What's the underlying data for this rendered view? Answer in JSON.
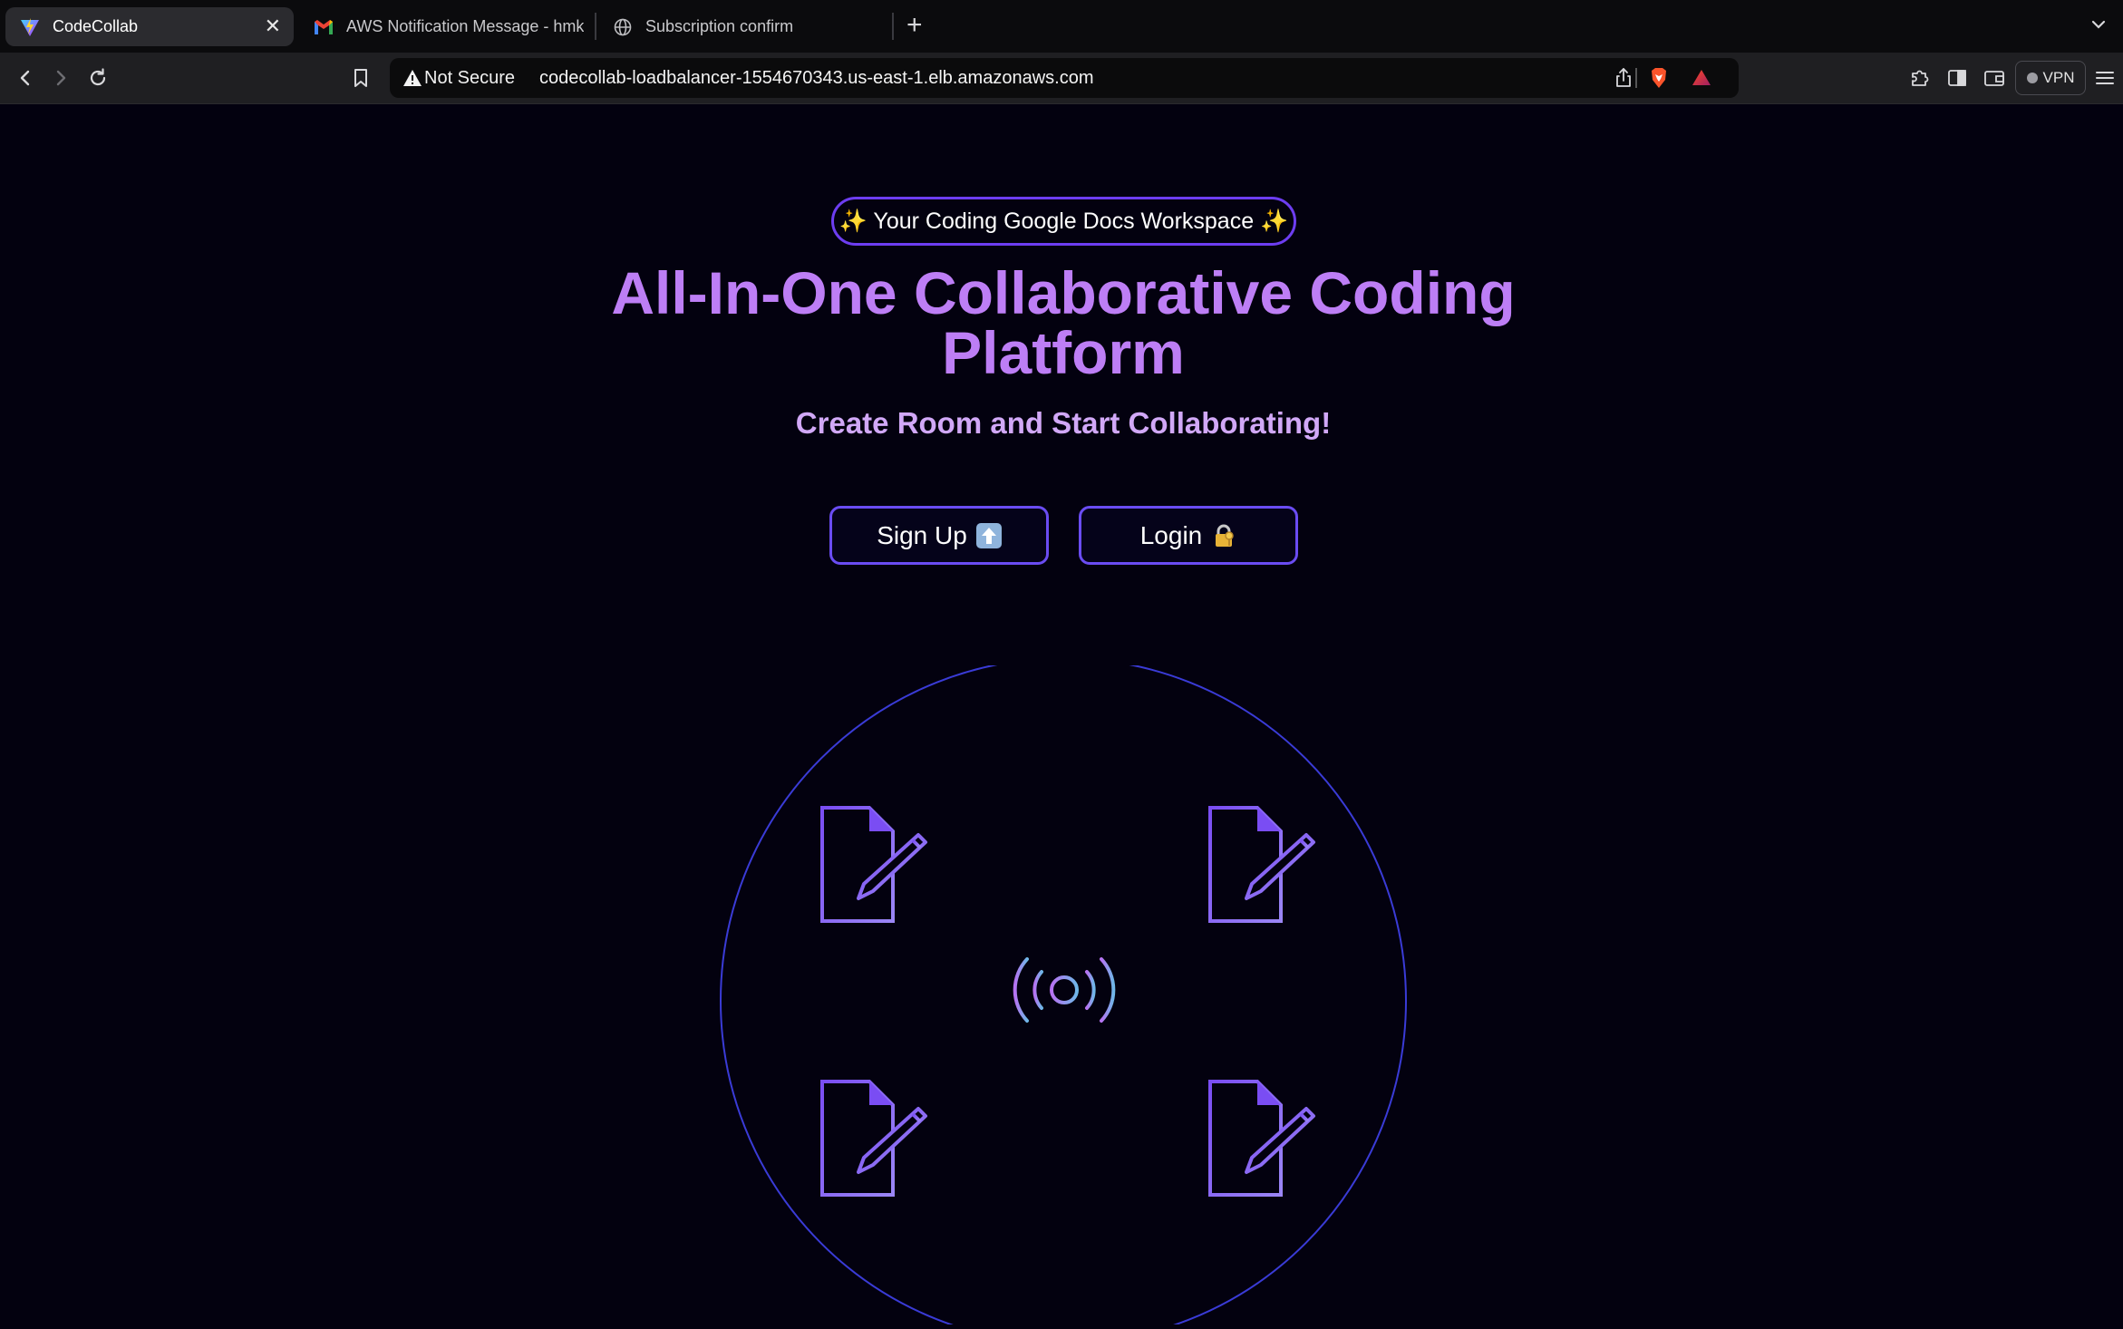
{
  "browser": {
    "tabs": [
      {
        "title": "CodeCollab",
        "active": true,
        "icon": "vite-logo-icon"
      },
      {
        "title": "AWS Notification Message - hmk",
        "active": false,
        "icon": "gmail-icon"
      },
      {
        "title": "Subscription confirm",
        "active": false,
        "icon": "globe-icon"
      }
    ],
    "security_label": "Not Secure",
    "url": "codecollab-loadbalancer-1554670343.us-east-1.elb.amazonaws.com",
    "vpn_label": "VPN"
  },
  "page": {
    "badge": "✨ Your Coding Google Docs Workspace ✨",
    "headline_line1": "All-In-One Collaborative Coding",
    "headline_line2": "Platform",
    "subtitle": "Create Room and Start Collaborating!",
    "signup_label": "Sign Up",
    "login_label": "Login",
    "colors": {
      "background": "#03010f",
      "headline": "#bd7ef5",
      "subtitle": "#d1a8f7",
      "accent_border": "#6a4cf2",
      "circle": "#3a3bd6"
    }
  }
}
